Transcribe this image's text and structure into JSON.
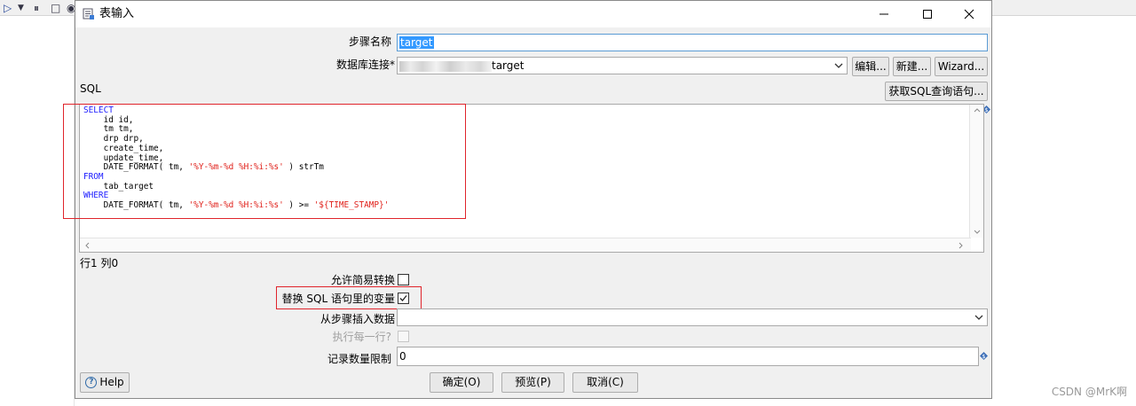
{
  "dialog": {
    "title": "表输入",
    "step_name_label": "步骤名称",
    "step_name_value": "target",
    "db_conn_label": "数据库连接*",
    "db_conn_value": "target",
    "edit_button": "编辑...",
    "new_button": "新建...",
    "wizard_button": "Wizard...",
    "sql_label": "SQL",
    "get_sql_button": "获取SQL查询语句...",
    "sql_lines": [
      {
        "parts": [
          {
            "t": "SELECT",
            "c": "kw"
          }
        ]
      },
      {
        "parts": [
          {
            "t": "    id id,",
            "c": ""
          }
        ]
      },
      {
        "parts": [
          {
            "t": "    tm tm,",
            "c": ""
          }
        ]
      },
      {
        "parts": [
          {
            "t": "    drp drp,",
            "c": ""
          }
        ]
      },
      {
        "parts": [
          {
            "t": "    create_time,",
            "c": ""
          }
        ]
      },
      {
        "parts": [
          {
            "t": "    update_time,",
            "c": ""
          }
        ]
      },
      {
        "parts": [
          {
            "t": "    DATE_FORMAT( tm, ",
            "c": ""
          },
          {
            "t": "'%Y-%m-%d %H:%i:%s'",
            "c": "str"
          },
          {
            "t": " ) strTm",
            "c": ""
          }
        ]
      },
      {
        "parts": [
          {
            "t": "FROM",
            "c": "kw"
          }
        ]
      },
      {
        "parts": [
          {
            "t": "    tab_target",
            "c": ""
          }
        ]
      },
      {
        "parts": [
          {
            "t": "WHERE",
            "c": "kw"
          }
        ]
      },
      {
        "parts": [
          {
            "t": "    DATE_FORMAT( tm, ",
            "c": ""
          },
          {
            "t": "'%Y-%m-%d %H:%i:%s'",
            "c": "str"
          },
          {
            "t": " ) >= ",
            "c": ""
          },
          {
            "t": "'${TIME_STAMP}'",
            "c": "str"
          }
        ]
      }
    ],
    "cursor_pos": "行1 列0",
    "lazy_conversion_label": "允许简易转换",
    "lazy_conversion_checked": false,
    "replace_vars_label": "替换 SQL 语句里的变量",
    "replace_vars_checked": true,
    "insert_from_step_label": "从步骤插入数据",
    "insert_from_step_value": "",
    "execute_each_row_label": "执行每一行?",
    "execute_each_row_checked": false,
    "limit_label": "记录数量限制",
    "limit_value": "0",
    "help_button": "Help",
    "ok_button": "确定(O)",
    "preview_button": "预览(P)",
    "cancel_button": "取消(C)"
  },
  "watermark": "CSDN @MrK啊",
  "colors": {
    "keyword": "#1a1aff",
    "string": "#e0201a",
    "highlight_box": "#e0242b",
    "selection": "#3399ff"
  }
}
